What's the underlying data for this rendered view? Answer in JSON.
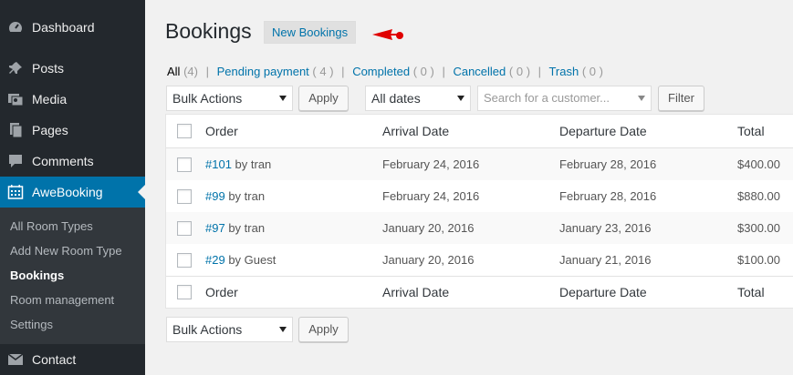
{
  "sidebar": {
    "items": [
      {
        "label": "Dashboard",
        "icon": "dashboard-icon"
      },
      {
        "label": "Posts",
        "icon": "pin-icon"
      },
      {
        "label": "Media",
        "icon": "media-icon"
      },
      {
        "label": "Pages",
        "icon": "pages-icon"
      },
      {
        "label": "Comments",
        "icon": "comment-icon"
      },
      {
        "label": "AweBooking",
        "icon": "calendar-icon"
      },
      {
        "label": "Contact",
        "icon": "mail-icon"
      }
    ],
    "submenu": [
      "All Room Types",
      "Add New Room Type",
      "Bookings",
      "Room management",
      "Settings"
    ]
  },
  "header": {
    "title": "Bookings",
    "add_new": "New Bookings"
  },
  "status_links": [
    {
      "label": "All",
      "count": "(4)"
    },
    {
      "label": "Pending payment",
      "count": "( 4 )"
    },
    {
      "label": "Completed",
      "count": "( 0 )"
    },
    {
      "label": "Cancelled",
      "count": "( 0 )"
    },
    {
      "label": "Trash",
      "count": "( 0 )"
    }
  ],
  "filters": {
    "bulk_actions": "Bulk Actions",
    "apply": "Apply",
    "dates": "All dates",
    "search_placeholder": "Search for a customer...",
    "filter": "Filter"
  },
  "table": {
    "columns": [
      "Order",
      "Arrival Date",
      "Departure Date",
      "Total"
    ],
    "rows": [
      {
        "order_link": "#101",
        "by": "by tran",
        "arrival": "February 24, 2016",
        "departure": "February 28, 2016",
        "total": "$400.00"
      },
      {
        "order_link": "#99",
        "by": "by tran",
        "arrival": "February 24, 2016",
        "departure": "February 28, 2016",
        "total": "$880.00"
      },
      {
        "order_link": "#97",
        "by": "by tran",
        "arrival": "January 20, 2016",
        "departure": "January 23, 2016",
        "total": "$300.00"
      },
      {
        "order_link": "#29",
        "by": "by Guest",
        "arrival": "January 20, 2016",
        "departure": "January 21, 2016",
        "total": "$100.00"
      }
    ]
  },
  "bottom": {
    "bulk_actions": "Bulk Actions",
    "apply": "Apply"
  }
}
